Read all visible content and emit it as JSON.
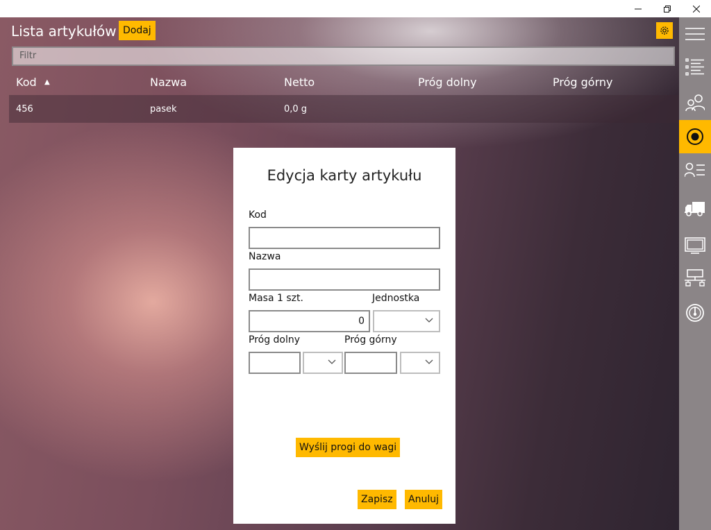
{
  "window": {
    "controls": [
      "minimize-icon",
      "restore-icon",
      "close-icon"
    ]
  },
  "header": {
    "title": "Lista artykułów",
    "add_label": "Dodaj",
    "settings_icon": "gear-icon"
  },
  "filter": {
    "placeholder": "Filtr"
  },
  "table": {
    "columns": [
      "Kod",
      "Nazwa",
      "Netto",
      "Próg dolny",
      "Próg górny"
    ],
    "sort_column": "Kod",
    "sort_direction": "ascending",
    "rows": [
      {
        "kod": "456",
        "nazwa": "pasek",
        "netto": "0,0 g",
        "prog_dolny": "",
        "prog_gorny": ""
      }
    ]
  },
  "dialog": {
    "title": "Edycja karty artykułu",
    "kod_label": "Kod",
    "kod_value": "",
    "nazwa_label": "Nazwa",
    "nazwa_value": "",
    "masa_label": "Masa 1 szt.",
    "masa_value": "0",
    "jednostka_label": "Jednostka",
    "jednostka_value": "",
    "prog_dolny_label": "Próg dolny",
    "prog_dolny_value": "",
    "prog_gorny_label": "Próg górny",
    "prog_gorny_value": "",
    "send_label": "Wyślij progi do wagi",
    "save_label": "Zapisz",
    "cancel_label": "Anuluj"
  },
  "sidebar": {
    "items": [
      {
        "icon": "hamburger-menu-icon",
        "active": false
      },
      {
        "icon": "article-list-icon",
        "active": false
      },
      {
        "icon": "users-icon",
        "active": false
      },
      {
        "icon": "radio-target-icon",
        "active": true
      },
      {
        "icon": "contact-list-icon",
        "active": false
      },
      {
        "icon": "truck-icon",
        "active": false
      },
      {
        "icon": "monitor-icon",
        "active": false
      },
      {
        "icon": "network-icon",
        "active": false
      },
      {
        "icon": "gauge-icon",
        "active": false
      }
    ]
  },
  "colors": {
    "accent": "#ffb900",
    "sidebar": "#8b8587",
    "dialog_bg": "#ffffff"
  }
}
